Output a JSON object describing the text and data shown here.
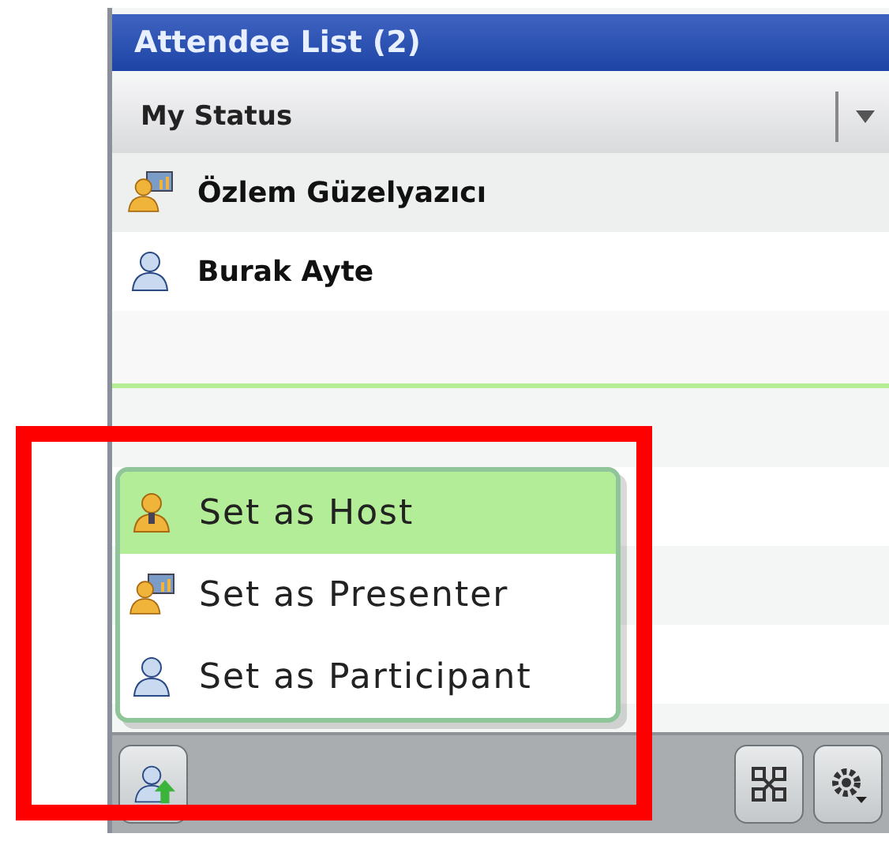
{
  "window": {
    "title": "Attendee List (2)"
  },
  "status_header": {
    "label": "My Status"
  },
  "attendees": [
    {
      "name": "Özlem Güzelyazıcı",
      "kind": "presenter",
      "selected": true
    },
    {
      "name": "Burak Ayte",
      "kind": "participant",
      "selected": false
    }
  ],
  "role_menu": [
    {
      "label": "Set as Host",
      "kind": "host",
      "selected": true
    },
    {
      "label": "Set as Presenter",
      "kind": "presenter",
      "selected": false
    },
    {
      "label": "Set as Participant",
      "kind": "participant",
      "selected": false
    }
  ],
  "toolbar": {
    "left": [
      {
        "kind": "role"
      }
    ],
    "right": [
      {
        "kind": "layout"
      },
      {
        "kind": "settings"
      }
    ]
  }
}
